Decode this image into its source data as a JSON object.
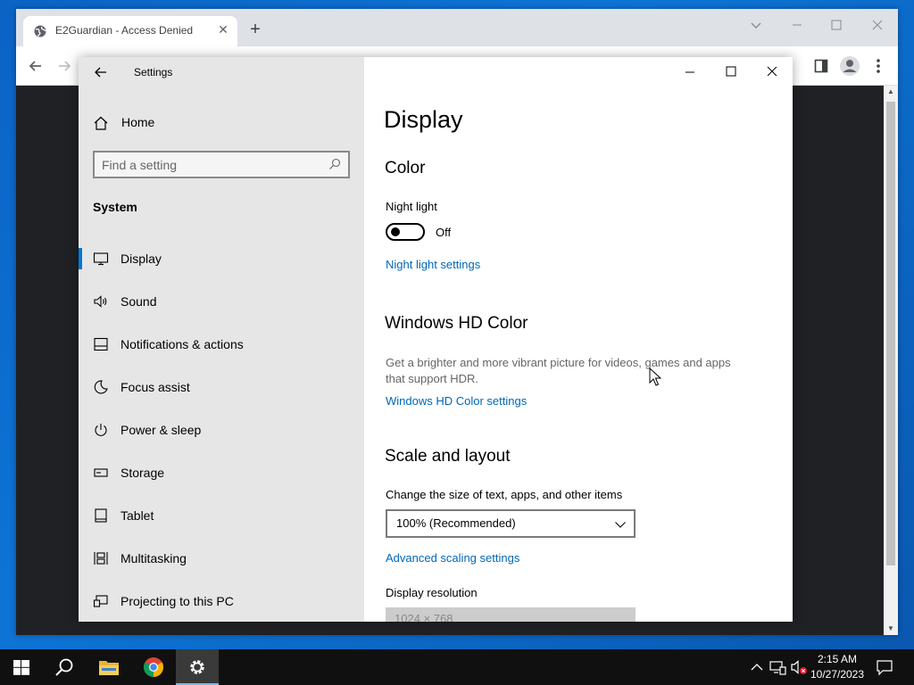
{
  "browser": {
    "tab_title": "E2Guardian - Access Denied",
    "tab_close": "✕",
    "new_tab": "+"
  },
  "settings": {
    "window_title": "Settings",
    "home_label": "Home",
    "search_placeholder": "Find a setting",
    "section_header": "System",
    "nav_items": [
      {
        "label": "Display",
        "icon": "monitor-icon",
        "active": true
      },
      {
        "label": "Sound",
        "icon": "speaker-icon"
      },
      {
        "label": "Notifications & actions",
        "icon": "notifications-icon"
      },
      {
        "label": "Focus assist",
        "icon": "moon-icon"
      },
      {
        "label": "Power & sleep",
        "icon": "power-icon"
      },
      {
        "label": "Storage",
        "icon": "storage-icon"
      },
      {
        "label": "Tablet",
        "icon": "tablet-icon"
      },
      {
        "label": "Multitasking",
        "icon": "multitasking-icon"
      },
      {
        "label": "Projecting to this PC",
        "icon": "projector-icon"
      }
    ],
    "content": {
      "page_title": "Display",
      "color_heading": "Color",
      "night_light_label": "Night light",
      "night_light_state": "Off",
      "night_light_on": false,
      "night_light_settings_link": "Night light settings",
      "hd_color_heading": "Windows HD Color",
      "hd_color_desc_line1": "Get a brighter and more vibrant picture for videos, games and apps",
      "hd_color_desc_line2": "that support HDR.",
      "hd_color_link": "Windows HD Color settings",
      "scale_heading": "Scale and layout",
      "scale_label": "Change the size of text, apps, and other items",
      "scale_value": "100% (Recommended)",
      "advanced_scaling_link": "Advanced scaling settings",
      "resolution_label": "Display resolution",
      "resolution_value": "1024 × 768"
    }
  },
  "taskbar": {
    "time": "2:15 AM",
    "date": "10/27/2023"
  },
  "colors": {
    "accent": "#0078d7",
    "link": "#0067b8",
    "sidebar_bg": "#e6e6e6",
    "taskbar_bg": "#101010"
  }
}
